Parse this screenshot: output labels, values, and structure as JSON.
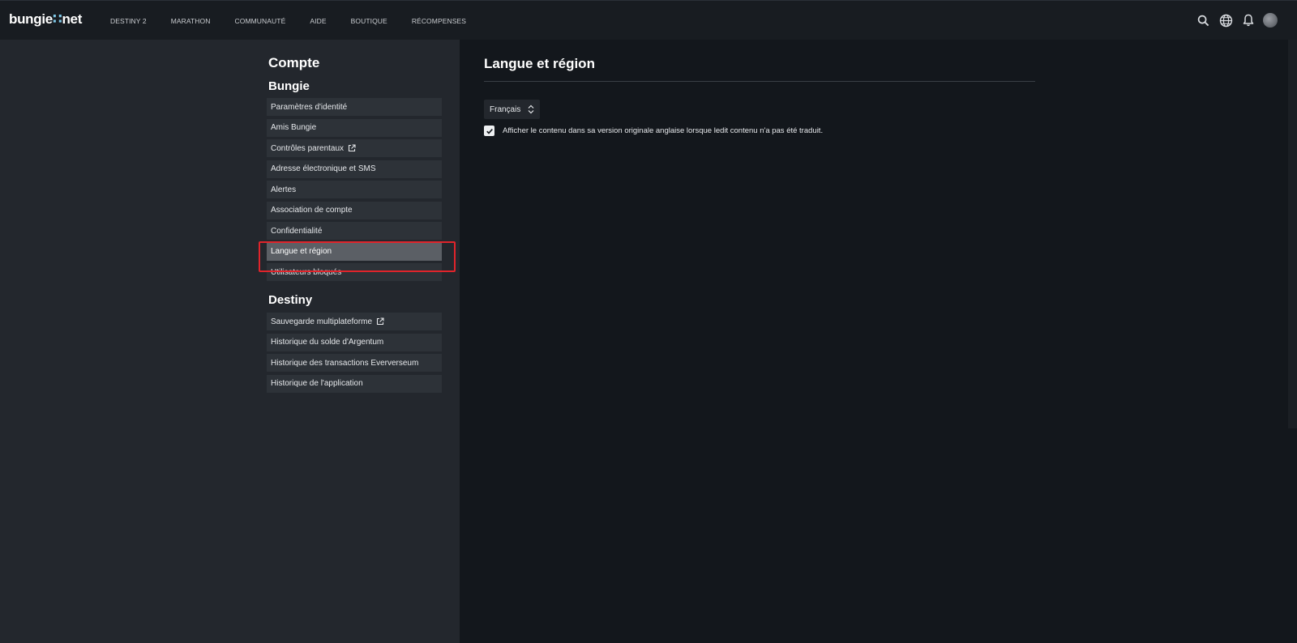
{
  "brand": {
    "logo_main": "bungie",
    "logo_dot": "∷",
    "logo_suffix": "net"
  },
  "nav": {
    "links": [
      "DESTINY 2",
      "MARATHON",
      "COMMUNAUTÉ",
      "AIDE",
      "BOUTIQUE",
      "RÉCOMPENSES"
    ],
    "icons": [
      "search-icon",
      "globe-icon",
      "bell-icon",
      "avatar"
    ]
  },
  "sidebar": {
    "title": "Compte",
    "sections": [
      {
        "heading": "Bungie",
        "items": [
          {
            "label": "Paramètres d'identité"
          },
          {
            "label": "Amis Bungie"
          },
          {
            "label": "Contrôles parentaux",
            "external": true
          },
          {
            "label": "Adresse électronique et SMS"
          },
          {
            "label": "Alertes"
          },
          {
            "label": "Association de compte"
          },
          {
            "label": "Confidentialité"
          },
          {
            "label": "Langue et région",
            "active": true
          },
          {
            "label": "Utilisateurs bloqués"
          }
        ]
      },
      {
        "heading": "Destiny",
        "items": [
          {
            "label": "Sauvegarde multiplateforme",
            "external": true
          },
          {
            "label": "Historique du solde d'Argentum"
          },
          {
            "label": "Historique des transactions Eververseum"
          },
          {
            "label": "Historique de l'application"
          }
        ]
      }
    ]
  },
  "main": {
    "title": "Langue et région",
    "language_select": {
      "value": "Français"
    },
    "fallback_checkbox": {
      "checked": true,
      "label": "Afficher le contenu dans sa version originale anglaise lorsque ledit contenu n'a pas été traduit."
    }
  },
  "colors": {
    "page_bg": "#13171c",
    "sidebar_bg": "#23272d",
    "item_bg": "#2d3238",
    "item_active_bg": "#5b5f65",
    "highlight": "#e0242b"
  }
}
